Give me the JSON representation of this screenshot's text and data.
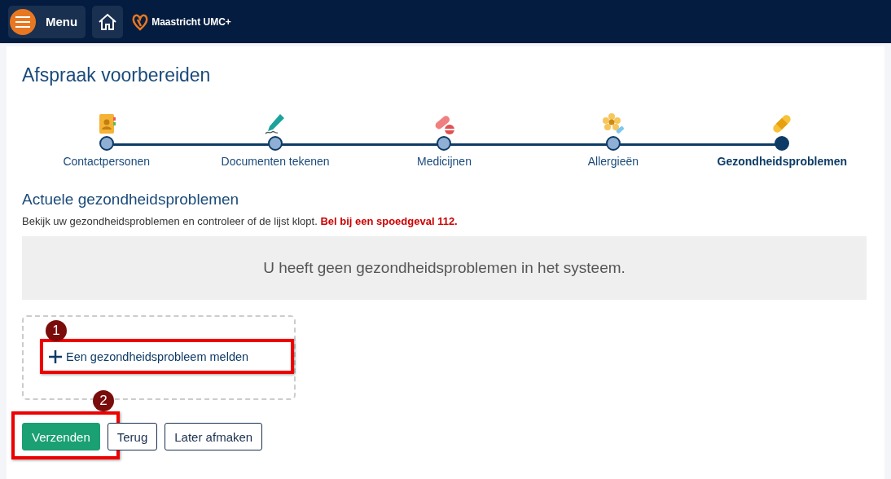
{
  "header": {
    "menu_label": "Menu",
    "brand": "Maastricht UMC+"
  },
  "title": "Afspraak voorbereiden",
  "steps": [
    {
      "label": "Contactpersonen",
      "kind": "contacts",
      "selected": false
    },
    {
      "label": "Documenten tekenen",
      "kind": "sign",
      "selected": false
    },
    {
      "label": "Medicijnen",
      "kind": "medicine",
      "selected": false
    },
    {
      "label": "Allergieën",
      "kind": "allergy",
      "selected": false
    },
    {
      "label": "Gezondheidsproblemen",
      "kind": "health",
      "selected": true
    }
  ],
  "section": {
    "heading": "Actuele gezondheidsproblemen",
    "description": "Bekijk uw gezondheidsproblemen en controleer of de lijst klopt.",
    "warning": "Bel bij een spoedgeval 112.",
    "empty_message": "U heeft geen gezondheidsproblemen in het systeem."
  },
  "add_link": {
    "label": "Een gezondheidsprobleem melden",
    "callout": "1"
  },
  "buttons": [
    {
      "label": "Verzenden",
      "kind": "primary",
      "callout": "2"
    },
    {
      "label": "Terug",
      "kind": "outline"
    },
    {
      "label": "Later afmaken",
      "kind": "outline"
    }
  ]
}
